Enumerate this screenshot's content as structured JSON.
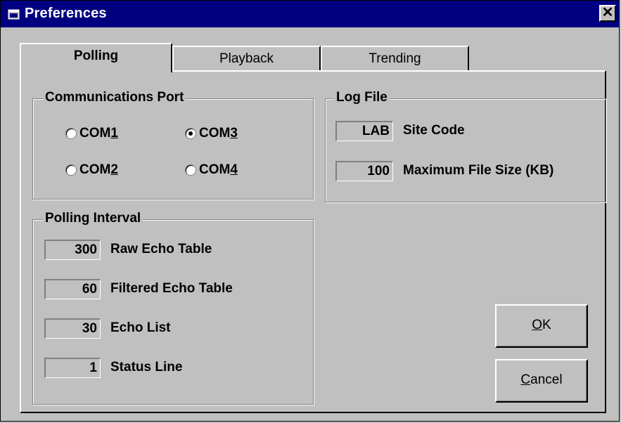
{
  "window": {
    "title": "Preferences",
    "close_glyph": "✕"
  },
  "tabs": [
    {
      "label": "Polling",
      "active": true
    },
    {
      "label": "Playback",
      "active": false
    },
    {
      "label": "Trending",
      "active": false
    }
  ],
  "communications_port": {
    "label": "Communications Port",
    "options": [
      {
        "prefix": "COM",
        "mnemonic": "1",
        "selected": false
      },
      {
        "prefix": "COM",
        "mnemonic": "3",
        "selected": true
      },
      {
        "prefix": "COM",
        "mnemonic": "2",
        "selected": false
      },
      {
        "prefix": "COM",
        "mnemonic": "4",
        "selected": false
      }
    ]
  },
  "log_file": {
    "label": "Log File",
    "site_code": {
      "value": "LAB",
      "label": "Site Code"
    },
    "max_file_size": {
      "value": "100",
      "label": "Maximum File Size (KB)"
    }
  },
  "polling_interval": {
    "label": "Polling Interval",
    "rows": [
      {
        "value": "300",
        "label": "Raw Echo Table"
      },
      {
        "value": "60",
        "label": "Filtered Echo Table"
      },
      {
        "value": "30",
        "label": "Echo List"
      },
      {
        "value": "1",
        "label": "Status Line"
      }
    ]
  },
  "buttons": {
    "ok": {
      "mnemonic": "O",
      "rest": "K"
    },
    "cancel": {
      "mnemonic": "C",
      "rest": "ancel"
    }
  },
  "colors": {
    "titlebar": "#000080",
    "face": "#c0c0c0"
  },
  "icons": {
    "app": "window-app-icon",
    "close": "close-icon"
  }
}
